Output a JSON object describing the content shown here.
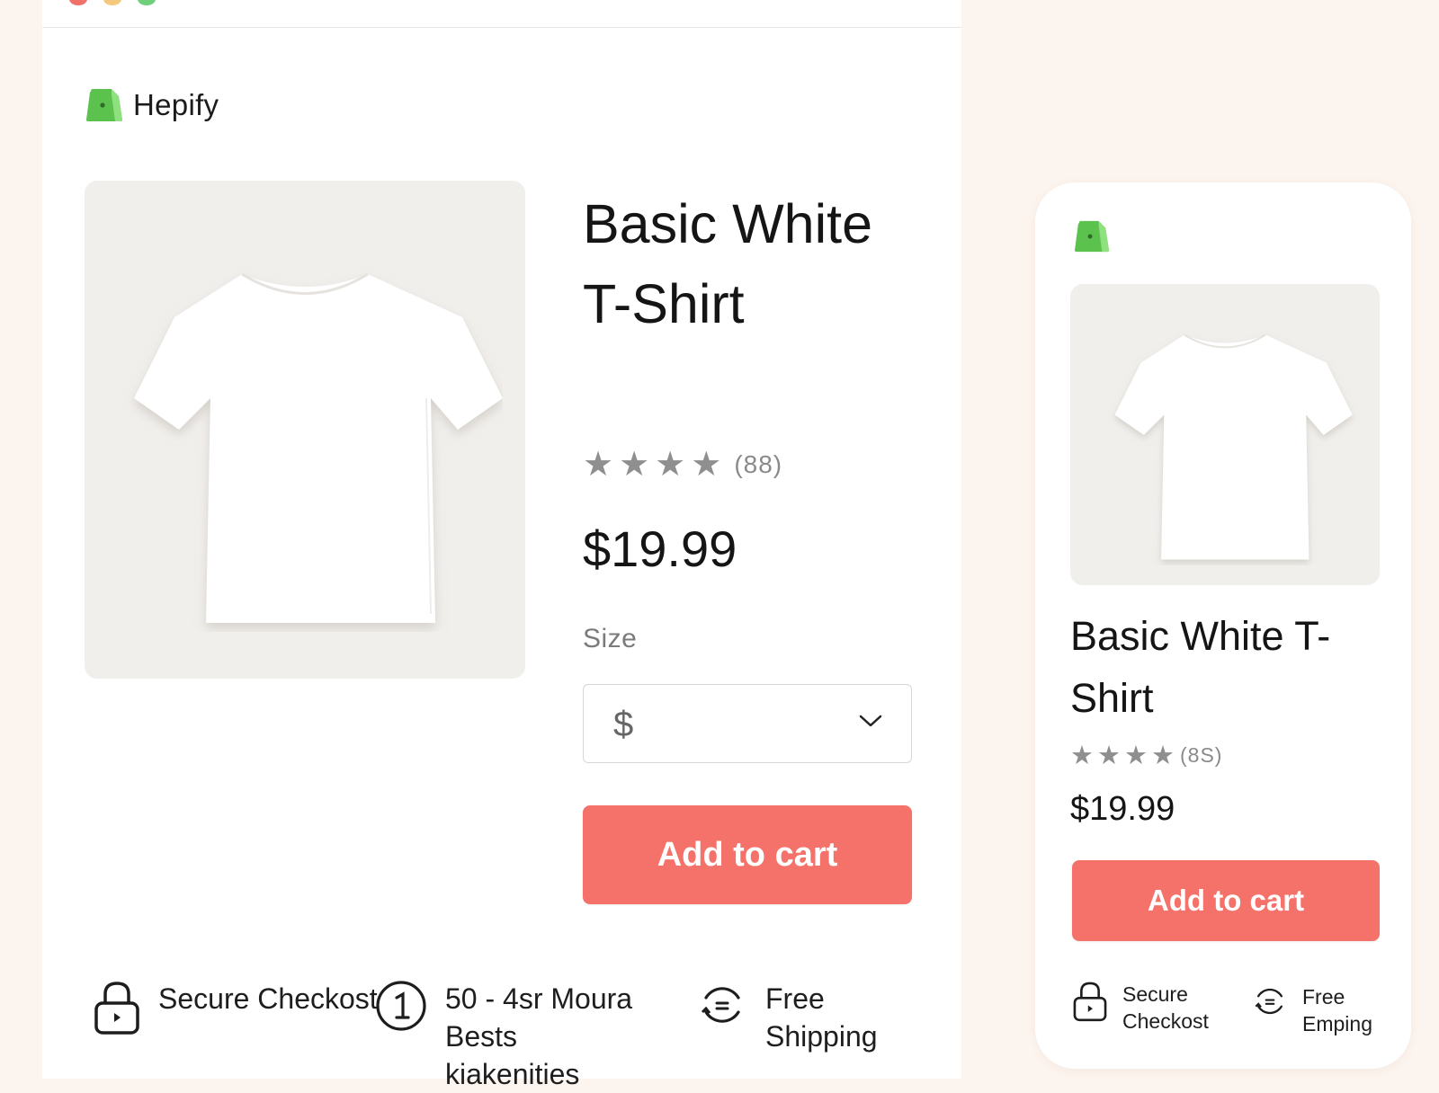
{
  "brand": {
    "name": "Hepify",
    "logo_icon": "green-shopping-bag-icon"
  },
  "colors": {
    "accent": "#f5726a",
    "background": "#fcf4ee",
    "brand_green": "#6ccf5e"
  },
  "desktop": {
    "product_title": "Basic White T-Shirt",
    "rating": {
      "stars": 4,
      "count_label": "(88)"
    },
    "price": "$19.99",
    "size": {
      "label": "Size",
      "selected": "$"
    },
    "add_to_cart": "Add to cart",
    "features": [
      {
        "icon": "lock-icon",
        "text": "Secure Checkost"
      },
      {
        "icon": "number-one-circle-icon",
        "text": "50 - 4sr Moura Bests kiakenities"
      },
      {
        "icon": "refresh-circle-icon",
        "text": "Free Shipping"
      }
    ]
  },
  "mobile": {
    "product_title": "Basic White T-Shirt",
    "rating": {
      "stars": 4,
      "count_label": "(8S)"
    },
    "price": "$19.99",
    "add_to_cart": "Add to cart",
    "features": [
      {
        "icon": "lock-icon",
        "text": "Secure Checkost"
      },
      {
        "icon": "refresh-circle-icon",
        "text": "Free Emping"
      }
    ]
  }
}
